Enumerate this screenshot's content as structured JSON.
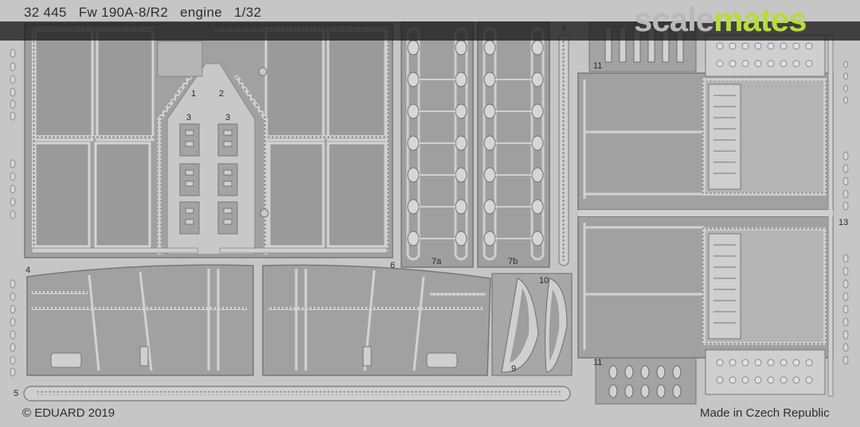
{
  "title": {
    "set_number": "32 445",
    "subject": "Fw 190A-8/R2",
    "part": "engine",
    "scale": "1/32"
  },
  "footer": {
    "copyright": "© EDUARD 2019",
    "made_in": "Made in Czech Republic"
  },
  "watermark": {
    "part_a": "scale",
    "part_b": "mates",
    "color_a": "#b9b9b9",
    "color_b": "#b8dc3c"
  },
  "part_numbers": {
    "p1": "1",
    "p2": "2",
    "p3a": "3",
    "p3b": "3",
    "p4": "4",
    "p5": "5",
    "p6": "6",
    "p7a": "7a",
    "p7b": "7b",
    "p8": "8",
    "p9": "9",
    "p10": "10",
    "p11a": "11",
    "p11b": "11",
    "p13": "13"
  },
  "colors": {
    "fret": "#c6c6c6",
    "panel": "#9f9f9f",
    "part_light": "#cfcfcf",
    "outline": "#6e6e6e"
  }
}
